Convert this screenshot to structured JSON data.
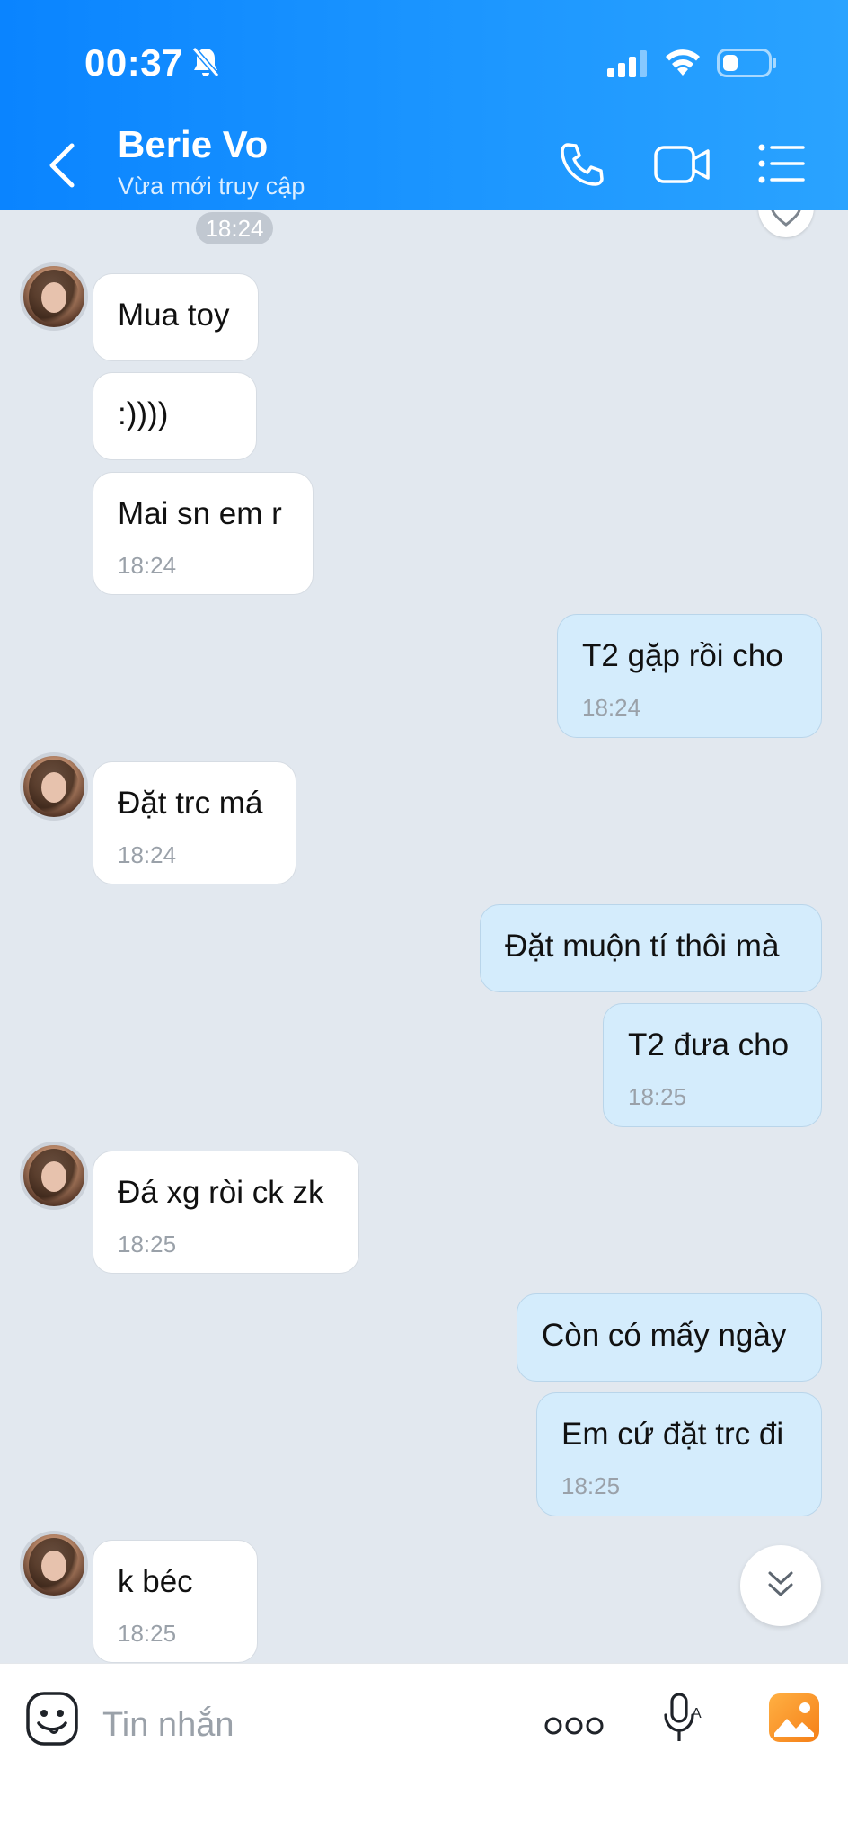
{
  "status_bar": {
    "time": "00:37"
  },
  "header": {
    "name": "Berie Vo",
    "status": "Vừa mới truy cập"
  },
  "chat": {
    "divider_time": "18:24",
    "messages": [
      {
        "dir": "in",
        "text": "Mua toy"
      },
      {
        "dir": "in",
        "text": ":))))"
      },
      {
        "dir": "in",
        "text": "Mai sn em r",
        "time": "18:24"
      },
      {
        "dir": "out",
        "text": "T2 gặp rồi cho",
        "time": "18:24"
      },
      {
        "dir": "in",
        "text": "Đặt trc má",
        "time": "18:24"
      },
      {
        "dir": "out",
        "text": "Đặt muộn tí thôi mà"
      },
      {
        "dir": "out",
        "text": "T2 đưa cho",
        "time": "18:25"
      },
      {
        "dir": "in",
        "text": "Đá xg ròi ck zk",
        "time": "18:25"
      },
      {
        "dir": "out",
        "text": "Còn có mấy ngày"
      },
      {
        "dir": "out",
        "text": "Em cứ đặt trc đi",
        "time": "18:25"
      },
      {
        "dir": "in",
        "text": "k béc",
        "time": "18:25"
      }
    ]
  },
  "composer": {
    "placeholder": "Tin nhắn"
  },
  "colors": {
    "header_blue": "#0a84ff",
    "incoming_bubble": "#ffffff",
    "outgoing_bubble": "#d4ecfc",
    "chat_background": "#e2e8ef"
  }
}
